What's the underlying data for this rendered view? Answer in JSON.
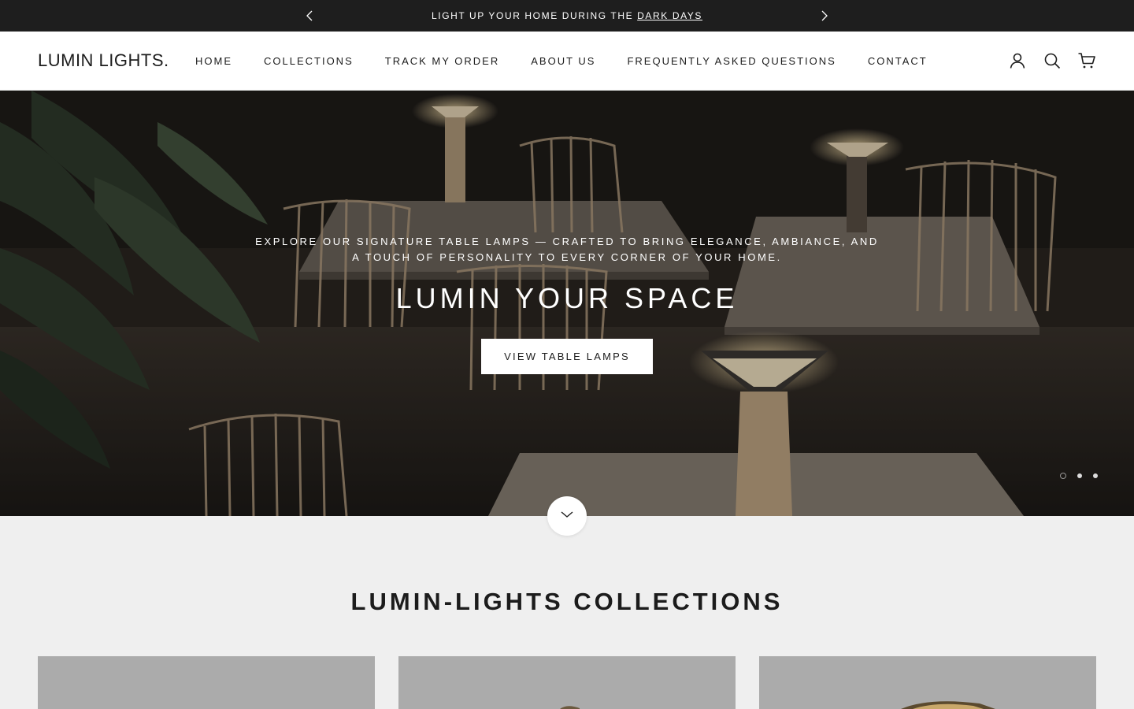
{
  "announcement": {
    "text": "LIGHT UP YOUR HOME DURING THE ",
    "link": "DARK DAYS"
  },
  "header": {
    "logo": "LUMIN LIGHTS.",
    "nav": [
      "HOME",
      "COLLECTIONS",
      "TRACK MY ORDER",
      "ABOUT US",
      "FREQUENTLY ASKED QUESTIONS",
      "CONTACT"
    ],
    "icons": [
      "account-icon",
      "search-icon",
      "cart-icon"
    ]
  },
  "hero": {
    "subtitle": "EXPLORE OUR SIGNATURE TABLE LAMPS — CRAFTED TO BRING ELEGANCE, AMBIANCE, AND A TOUCH OF PERSONALITY TO EVERY CORNER OF YOUR HOME.",
    "title": "LUMIN YOUR SPACE",
    "button": "VIEW TABLE LAMPS",
    "slides": 3,
    "active_slide": 1
  },
  "collections": {
    "title": "LUMIN-LIGHTS COLLECTIONS",
    "cards": 3
  }
}
